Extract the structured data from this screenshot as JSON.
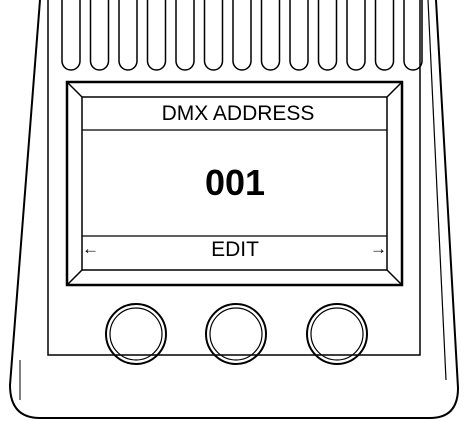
{
  "display": {
    "title": "DMX ADDRESS",
    "value": "001",
    "action": "EDIT",
    "left_arrow": "←",
    "right_arrow": "→"
  },
  "icons": {
    "left_arrow": "arrow-left-icon",
    "right_arrow": "arrow-right-icon"
  },
  "buttons": [
    {
      "name": "left-button"
    },
    {
      "name": "middle-button"
    },
    {
      "name": "right-button"
    }
  ],
  "colors": {
    "line": "#000000",
    "background": "#ffffff"
  }
}
